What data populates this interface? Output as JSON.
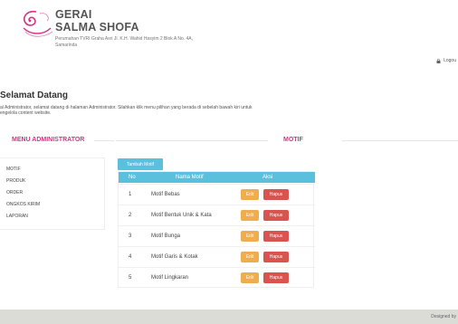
{
  "brand": {
    "line1": "GERAI",
    "line2": "SALMA SHOFA",
    "address_line1": "Perumahan TVRI Graha Asri Jl. K.H. Wahid Hasyim 2 Blok A No. 4A,",
    "address_line2": "Samarinda"
  },
  "header": {
    "logout_label": "Logou"
  },
  "welcome": {
    "title": "Selamat Datang",
    "text_line1": "ai Administrator, selamat datang di halaman Administrator. Silahkan klik menu pilihan yang berada di sebelah bawah kiri untuk",
    "text_line2": "engelola content website."
  },
  "sidebar": {
    "title": "MENU ADMINISTRATOR",
    "items": [
      {
        "label": "MOTIF"
      },
      {
        "label": "PRODUK"
      },
      {
        "label": "ORDER"
      },
      {
        "label": "ONGKOS KIRIM"
      },
      {
        "label": "LAPORAN"
      }
    ]
  },
  "main": {
    "title": "MOTIF",
    "add_button": "Tambah Motif",
    "table": {
      "headers": [
        "No",
        "Nama Motif",
        "Aksi"
      ],
      "rows": [
        {
          "no": "1",
          "name": "Motif Bebas",
          "edit": "Edit",
          "delete": "Hapus"
        },
        {
          "no": "2",
          "name": "Motif Bentuk Unik & Kata",
          "edit": "Edit",
          "delete": "Hapus"
        },
        {
          "no": "3",
          "name": "Motif Bunga",
          "edit": "Edit",
          "delete": "Hapus"
        },
        {
          "no": "4",
          "name": "Motif Garis & Kotak",
          "edit": "Edit",
          "delete": "Hapus"
        },
        {
          "no": "5",
          "name": "Motif Lingkaran",
          "edit": "Edit",
          "delete": "Hapus"
        }
      ]
    }
  },
  "footer": {
    "text": "Designed by"
  },
  "colors": {
    "accent_pink": "#d63384",
    "header_blue": "#5bc0de",
    "edit_orange": "#f0ad4e",
    "delete_red": "#d9534f",
    "footer_bg": "#dcdcd6"
  },
  "icons": {
    "logo": "ornament-logo-icon",
    "logout": "lock-icon"
  }
}
